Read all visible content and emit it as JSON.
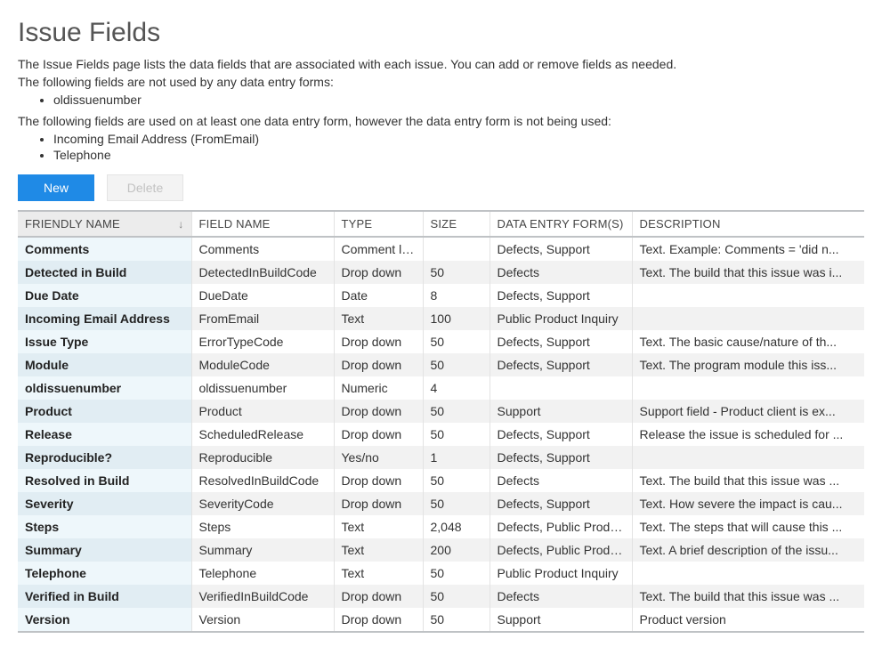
{
  "page": {
    "title": "Issue Fields",
    "intro": "The Issue Fields page lists the data fields that are associated with each issue. You can add or remove fields as needed.",
    "unused_note": "The following fields are not used by any data entry forms:",
    "unused_items": [
      "oldissuenumber"
    ],
    "unusedform_note": "The following fields are used on at least one data entry form, however the data entry form is not being used:",
    "unusedform_items": [
      "Incoming Email Address (FromEmail)",
      "Telephone"
    ]
  },
  "toolbar": {
    "new_label": "New",
    "delete_label": "Delete"
  },
  "columns": {
    "friendly": "FRIENDLY NAME",
    "field": "FIELD NAME",
    "type": "TYPE",
    "size": "SIZE",
    "forms": "DATA ENTRY FORM(S)",
    "desc": "DESCRIPTION"
  },
  "rows": [
    {
      "friendly": "Comments",
      "field": "Comments",
      "type": "Comment log",
      "size": "",
      "forms": "Defects, Support",
      "desc": "Text. Example: Comments = 'did n..."
    },
    {
      "friendly": "Detected in Build",
      "field": "DetectedInBuildCode",
      "type": "Drop down",
      "size": "50",
      "forms": "Defects",
      "desc": "Text. The build that this issue was i..."
    },
    {
      "friendly": "Due Date",
      "field": "DueDate",
      "type": "Date",
      "size": "8",
      "forms": "Defects, Support",
      "desc": ""
    },
    {
      "friendly": "Incoming Email Address",
      "field": "FromEmail",
      "type": "Text",
      "size": "100",
      "forms": "Public Product Inquiry",
      "desc": ""
    },
    {
      "friendly": "Issue Type",
      "field": "ErrorTypeCode",
      "type": "Drop down",
      "size": "50",
      "forms": "Defects, Support",
      "desc": "Text. The basic cause/nature of th..."
    },
    {
      "friendly": "Module",
      "field": "ModuleCode",
      "type": "Drop down",
      "size": "50",
      "forms": "Defects, Support",
      "desc": "Text. The program module this iss..."
    },
    {
      "friendly": "oldissuenumber",
      "field": "oldissuenumber",
      "type": "Numeric",
      "size": "4",
      "forms": "",
      "desc": ""
    },
    {
      "friendly": "Product",
      "field": "Product",
      "type": "Drop down",
      "size": "50",
      "forms": "Support",
      "desc": "Support field - Product client is ex..."
    },
    {
      "friendly": "Release",
      "field": "ScheduledRelease",
      "type": "Drop down",
      "size": "50",
      "forms": "Defects, Support",
      "desc": "Release the issue is scheduled for ..."
    },
    {
      "friendly": "Reproducible?",
      "field": "Reproducible",
      "type": "Yes/no",
      "size": "1",
      "forms": "Defects, Support",
      "desc": ""
    },
    {
      "friendly": "Resolved in Build",
      "field": "ResolvedInBuildCode",
      "type": "Drop down",
      "size": "50",
      "forms": "Defects",
      "desc": "Text. The build that this issue was ..."
    },
    {
      "friendly": "Severity",
      "field": "SeverityCode",
      "type": "Drop down",
      "size": "50",
      "forms": "Defects, Support",
      "desc": "Text. How severe the impact is cau..."
    },
    {
      "friendly": "Steps",
      "field": "Steps",
      "type": "Text",
      "size": "2,048",
      "forms": "Defects, Public Produc...",
      "desc": "Text. The steps that will cause this ..."
    },
    {
      "friendly": "Summary",
      "field": "Summary",
      "type": "Text",
      "size": "200",
      "forms": "Defects, Public Produc...",
      "desc": "Text. A brief description of the issu..."
    },
    {
      "friendly": "Telephone",
      "field": "Telephone",
      "type": "Text",
      "size": "50",
      "forms": "Public Product Inquiry",
      "desc": ""
    },
    {
      "friendly": "Verified in Build",
      "field": "VerifiedInBuildCode",
      "type": "Drop down",
      "size": "50",
      "forms": "Defects",
      "desc": "Text. The build that this issue was ..."
    },
    {
      "friendly": "Version",
      "field": "Version",
      "type": "Drop down",
      "size": "50",
      "forms": "Support",
      "desc": "Product version"
    }
  ]
}
